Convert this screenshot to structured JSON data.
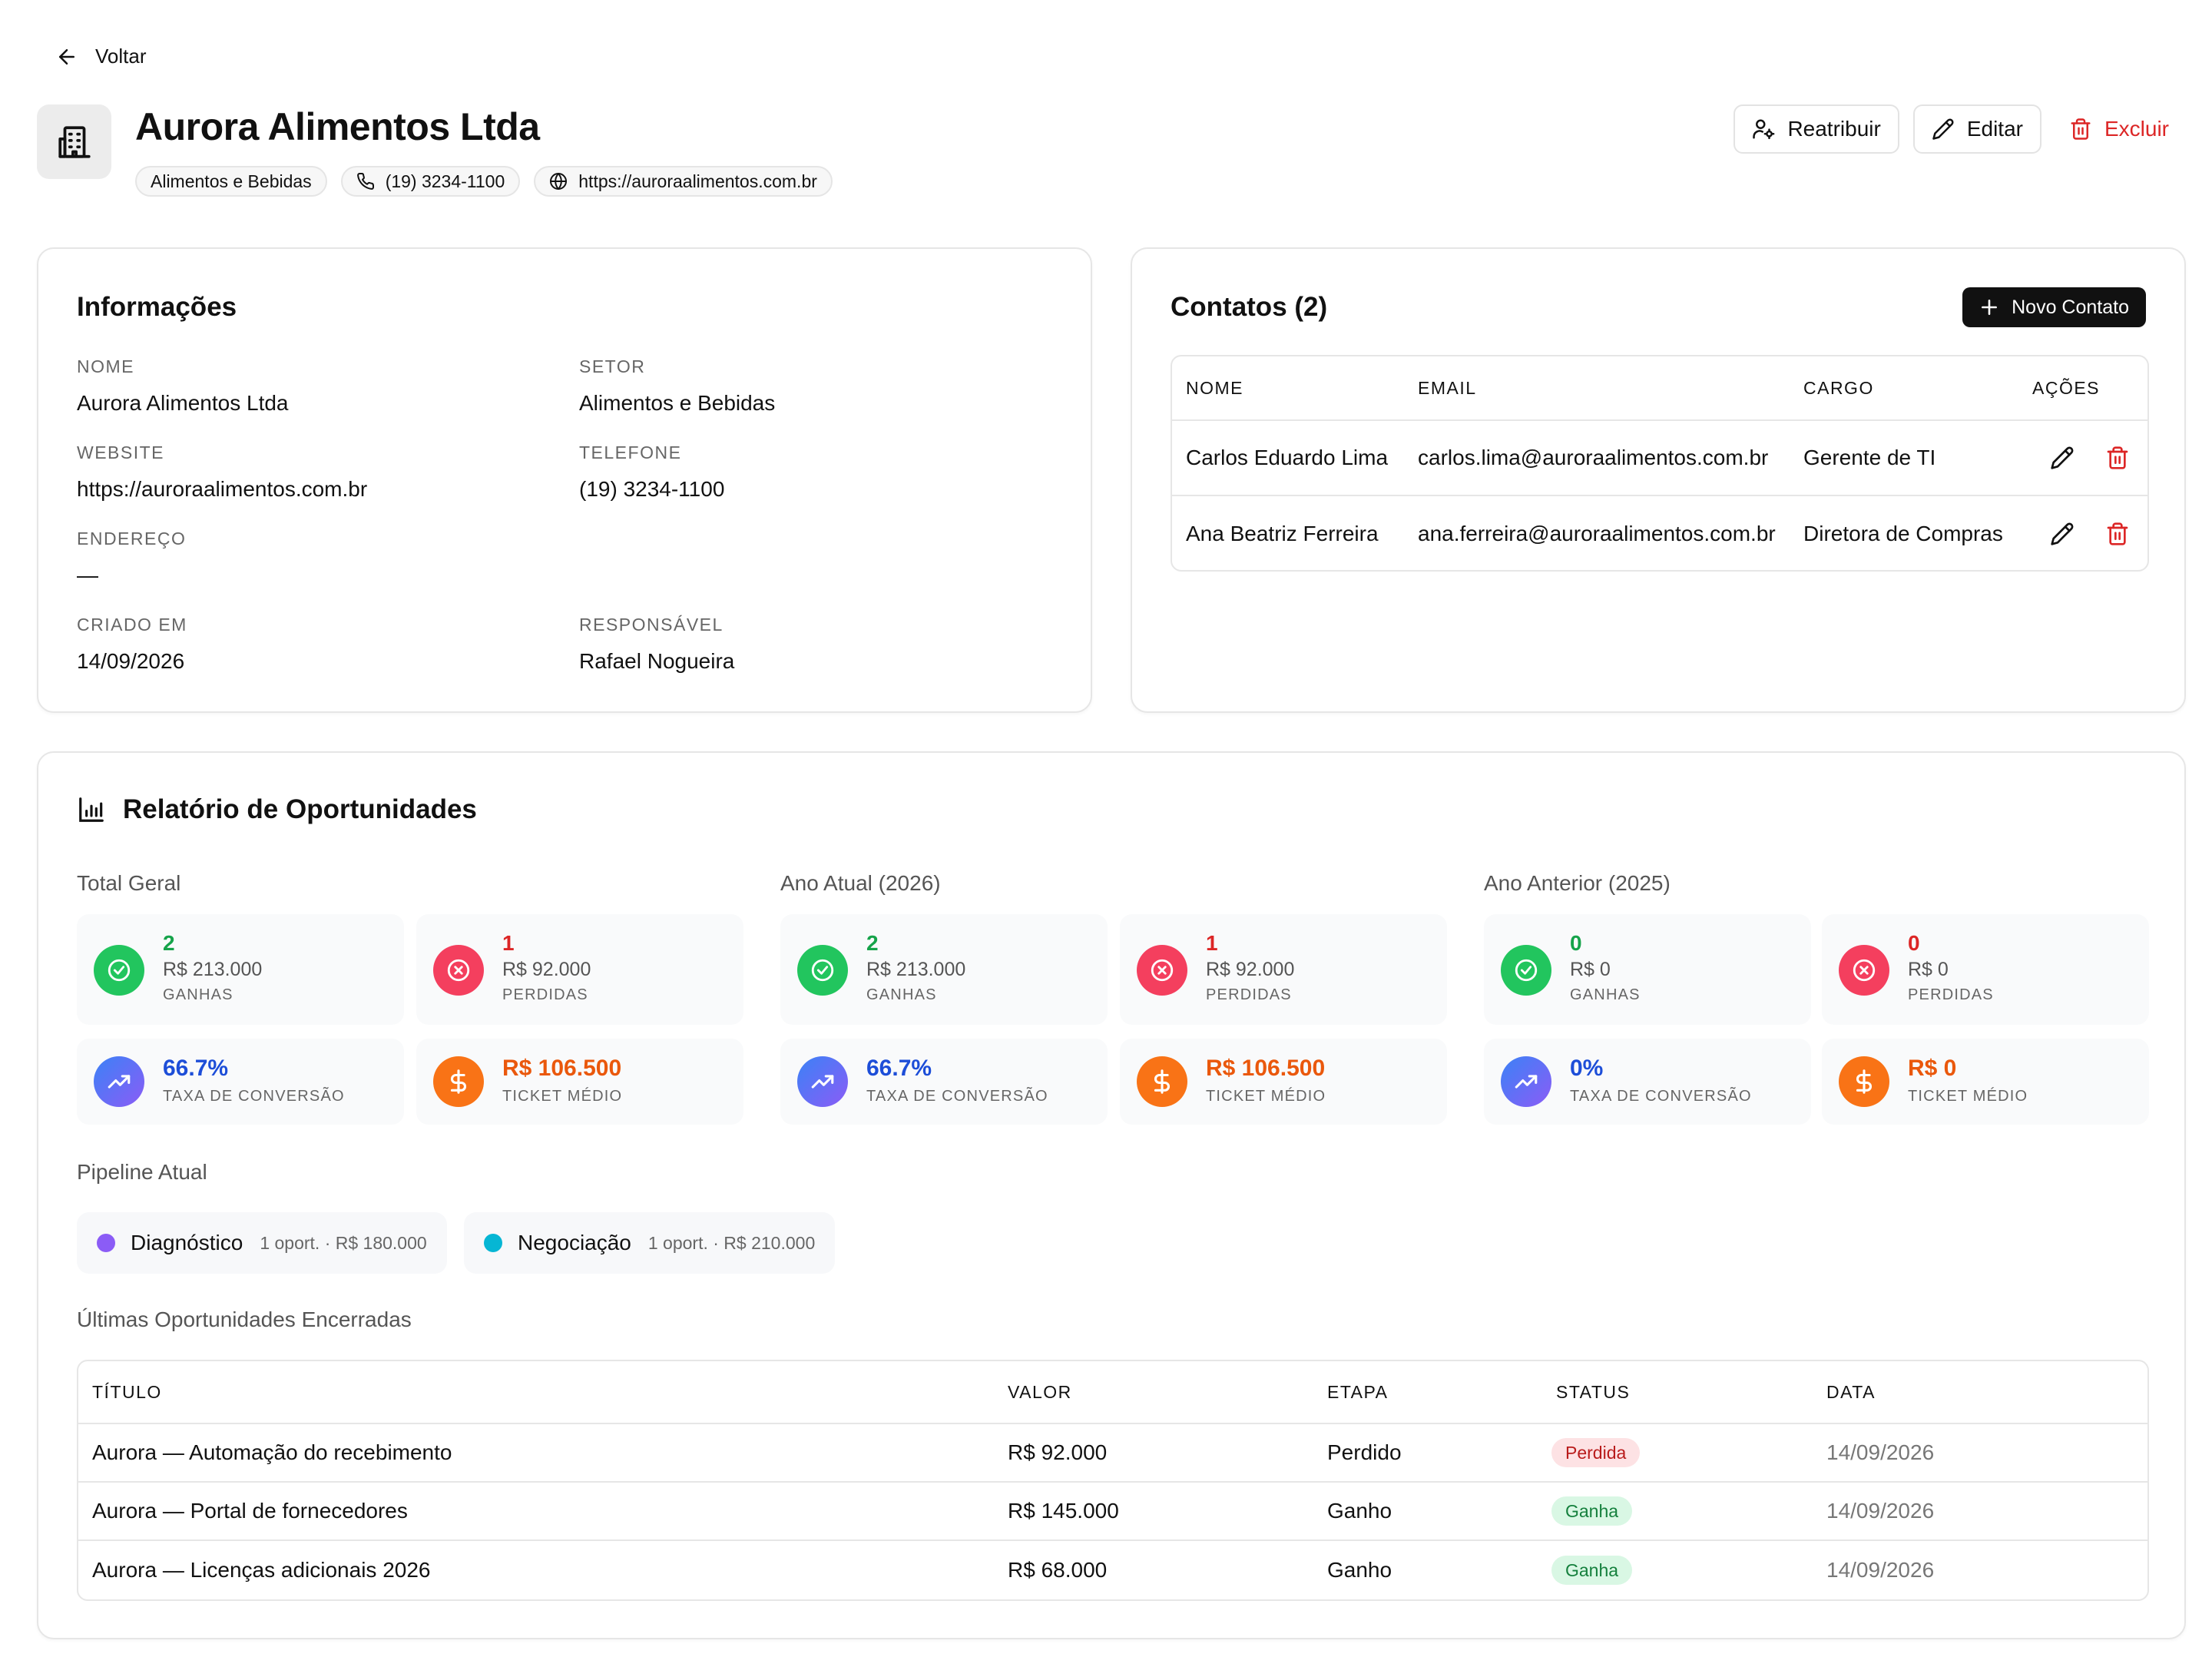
{
  "nav": {
    "back_label": "Voltar"
  },
  "company": {
    "name": "Aurora Alimentos Ltda",
    "chips": {
      "sector": "Alimentos e Bebidas",
      "phone": "(19) 3234-1100",
      "website": "https://auroraalimentos.com.br"
    }
  },
  "actions": {
    "reassign": "Reatribuir",
    "edit": "Editar",
    "delete": "Excluir"
  },
  "info": {
    "title": "Informações",
    "fields": {
      "name": {
        "label": "NOME",
        "value": "Aurora Alimentos Ltda"
      },
      "sector": {
        "label": "SETOR",
        "value": "Alimentos e Bebidas"
      },
      "website": {
        "label": "WEBSITE",
        "value": "https://auroraalimentos.com.br"
      },
      "phone": {
        "label": "TELEFONE",
        "value": "(19) 3234-1100"
      },
      "address": {
        "label": "ENDEREÇO",
        "value": "—"
      },
      "created": {
        "label": "CRIADO EM",
        "value": "14/09/2026"
      },
      "owner": {
        "label": "RESPONSÁVEL",
        "value": "Rafael Nogueira"
      }
    }
  },
  "contacts": {
    "title": "Contatos (2)",
    "new_button": "Novo Contato",
    "columns": {
      "name": "NOME",
      "email": "EMAIL",
      "role": "CARGO",
      "actions": "AÇÕES"
    },
    "rows": [
      {
        "name": "Carlos Eduardo Lima",
        "email": "carlos.lima@auroraalimentos.com.br",
        "role": "Gerente de TI"
      },
      {
        "name": "Ana Beatriz Ferreira",
        "email": "ana.ferreira@auroraalimentos.com.br",
        "role": "Diretora de Compras"
      }
    ]
  },
  "report": {
    "title": "Relatório de Oportunidades",
    "groups": [
      {
        "title": "Total Geral",
        "won": {
          "count": "2",
          "amount": "R$ 213.000",
          "label": "GANHAS"
        },
        "lost": {
          "count": "1",
          "amount": "R$ 92.000",
          "label": "PERDIDAS"
        },
        "conversion": {
          "value": "66.7%",
          "label": "TAXA DE CONVERSÃO"
        },
        "ticket": {
          "value": "R$ 106.500",
          "label": "TICKET MÉDIO"
        }
      },
      {
        "title": "Ano Atual (2026)",
        "won": {
          "count": "2",
          "amount": "R$ 213.000",
          "label": "GANHAS"
        },
        "lost": {
          "count": "1",
          "amount": "R$ 92.000",
          "label": "PERDIDAS"
        },
        "conversion": {
          "value": "66.7%",
          "label": "TAXA DE CONVERSÃO"
        },
        "ticket": {
          "value": "R$ 106.500",
          "label": "TICKET MÉDIO"
        }
      },
      {
        "title": "Ano Anterior (2025)",
        "won": {
          "count": "0",
          "amount": "R$ 0",
          "label": "GANHAS"
        },
        "lost": {
          "count": "0",
          "amount": "R$ 0",
          "label": "PERDIDAS"
        },
        "conversion": {
          "value": "0%",
          "label": "TAXA DE CONVERSÃO"
        },
        "ticket": {
          "value": "R$ 0",
          "label": "TICKET MÉDIO"
        }
      }
    ],
    "pipeline": {
      "title": "Pipeline Atual",
      "stages": [
        {
          "name": "Diagnóstico",
          "meta": "1 oport. · R$ 180.000",
          "color": "#8b5cf6"
        },
        {
          "name": "Negociação",
          "meta": "1 oport. · R$ 210.000",
          "color": "#06b6d4"
        }
      ]
    },
    "closed": {
      "title": "Últimas Oportunidades Encerradas",
      "columns": {
        "title": "TÍTULO",
        "value": "VALOR",
        "stage": "ETAPA",
        "status": "STATUS",
        "date": "DATA"
      },
      "rows": [
        {
          "title": "Aurora — Automação do recebimento",
          "value": "R$ 92.000",
          "stage": "Perdido",
          "status": "Perdida",
          "date": "14/09/2026"
        },
        {
          "title": "Aurora — Portal de fornecedores",
          "value": "R$ 145.000",
          "stage": "Ganho",
          "status": "Ganha",
          "date": "14/09/2026"
        },
        {
          "title": "Aurora — Licenças adicionais 2026",
          "value": "R$ 68.000",
          "stage": "Ganho",
          "status": "Ganha",
          "date": "14/09/2026"
        }
      ]
    }
  },
  "colors": {
    "danger": "#dc2626",
    "success": "#22c55e",
    "warning": "#f97316",
    "primary_dark": "#111111"
  }
}
